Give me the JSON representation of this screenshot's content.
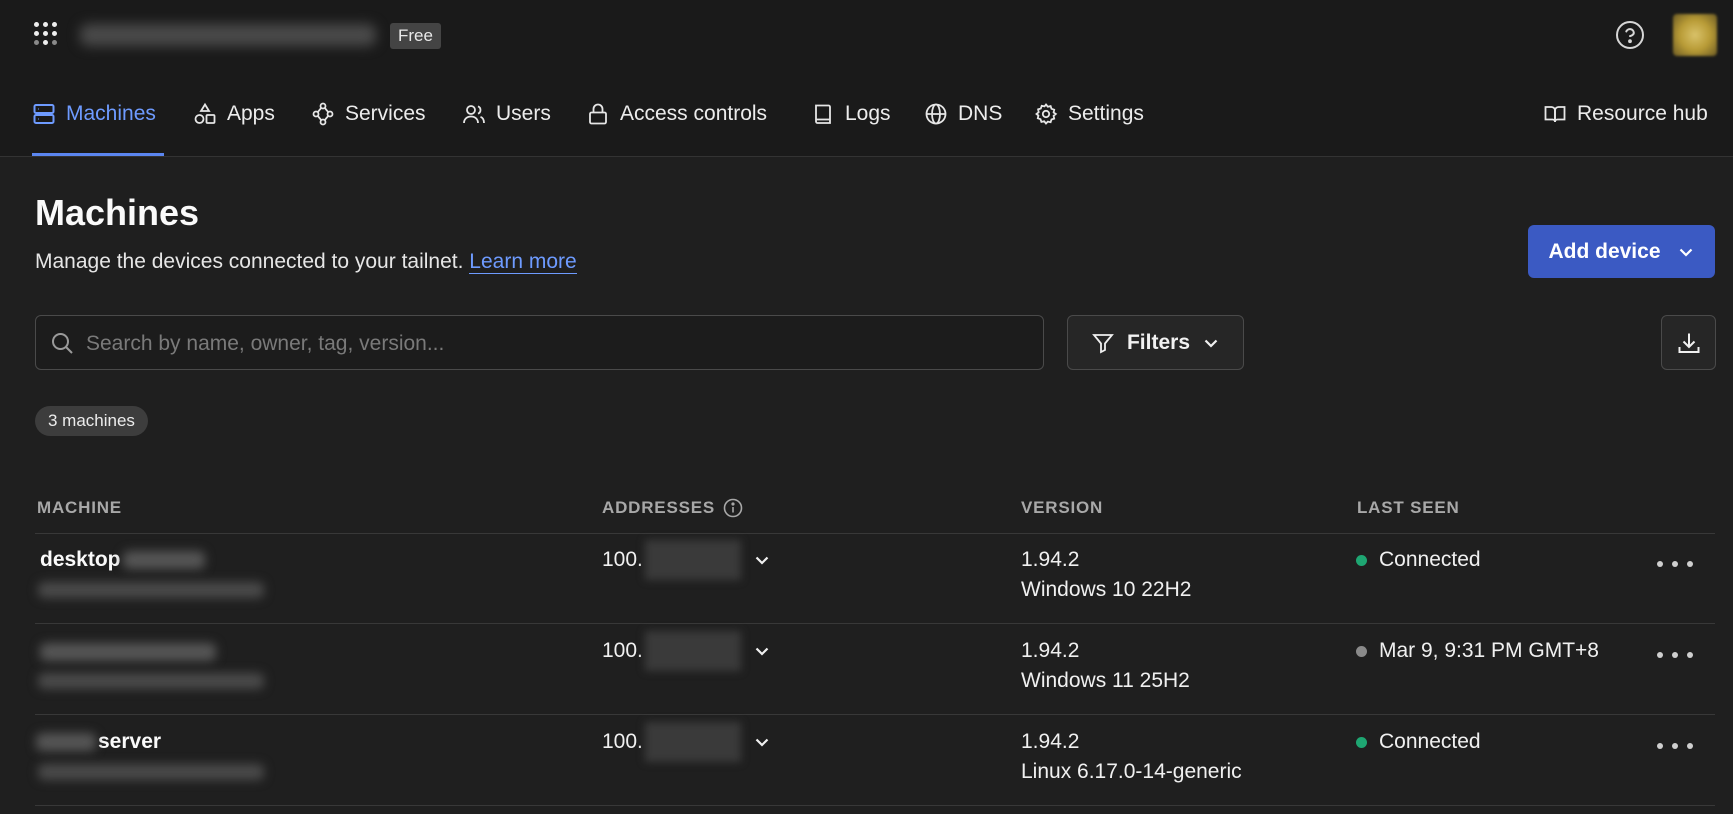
{
  "header": {
    "plan_badge": "Free",
    "help_icon": "help-circle-icon",
    "apps_icon": "app-grid-dots-icon"
  },
  "nav": {
    "items": [
      {
        "label": "Machines",
        "icon": "server-icon",
        "active": true
      },
      {
        "label": "Apps",
        "icon": "apps-shapes-icon"
      },
      {
        "label": "Services",
        "icon": "services-network-icon"
      },
      {
        "label": "Users",
        "icon": "users-icon"
      },
      {
        "label": "Access controls",
        "icon": "lock-icon"
      },
      {
        "label": "Logs",
        "icon": "book-icon"
      },
      {
        "label": "DNS",
        "icon": "globe-icon"
      },
      {
        "label": "Settings",
        "icon": "gear-icon"
      }
    ],
    "resource_hub": {
      "label": "Resource hub",
      "icon": "open-book-icon"
    }
  },
  "page": {
    "title": "Machines",
    "subtitle": "Manage the devices connected to your tailnet.",
    "learn_more": "Learn more",
    "add_device": "Add device"
  },
  "toolbar": {
    "search_placeholder": "Search by name, owner, tag, version...",
    "filters_label": "Filters"
  },
  "machines_count": "3 machines",
  "table": {
    "headers": {
      "machine": "MACHINE",
      "addresses": "ADDRESSES",
      "version": "VERSION",
      "last_seen": "LAST SEEN"
    },
    "rows": [
      {
        "name": "desktop",
        "address_prefix": "100.",
        "version": "1.94.2",
        "os": "Windows 10 22H2",
        "last_seen": "Connected",
        "status_color": "#1ea672"
      },
      {
        "name": "",
        "address_prefix": "100.",
        "version": "1.94.2",
        "os": "Windows 11 25H2",
        "last_seen": "Mar 9, 9:31 PM GMT+8",
        "status_color": "#8a8a8a"
      },
      {
        "name": "server",
        "address_prefix": "100.",
        "version": "1.94.2",
        "os": "Linux 6.17.0-14-generic",
        "last_seen": "Connected",
        "status_color": "#1ea672"
      }
    ]
  },
  "colors": {
    "accent": "#6e9bff",
    "primary_button": "#3b5ac3",
    "background": "#1f1f1f"
  }
}
